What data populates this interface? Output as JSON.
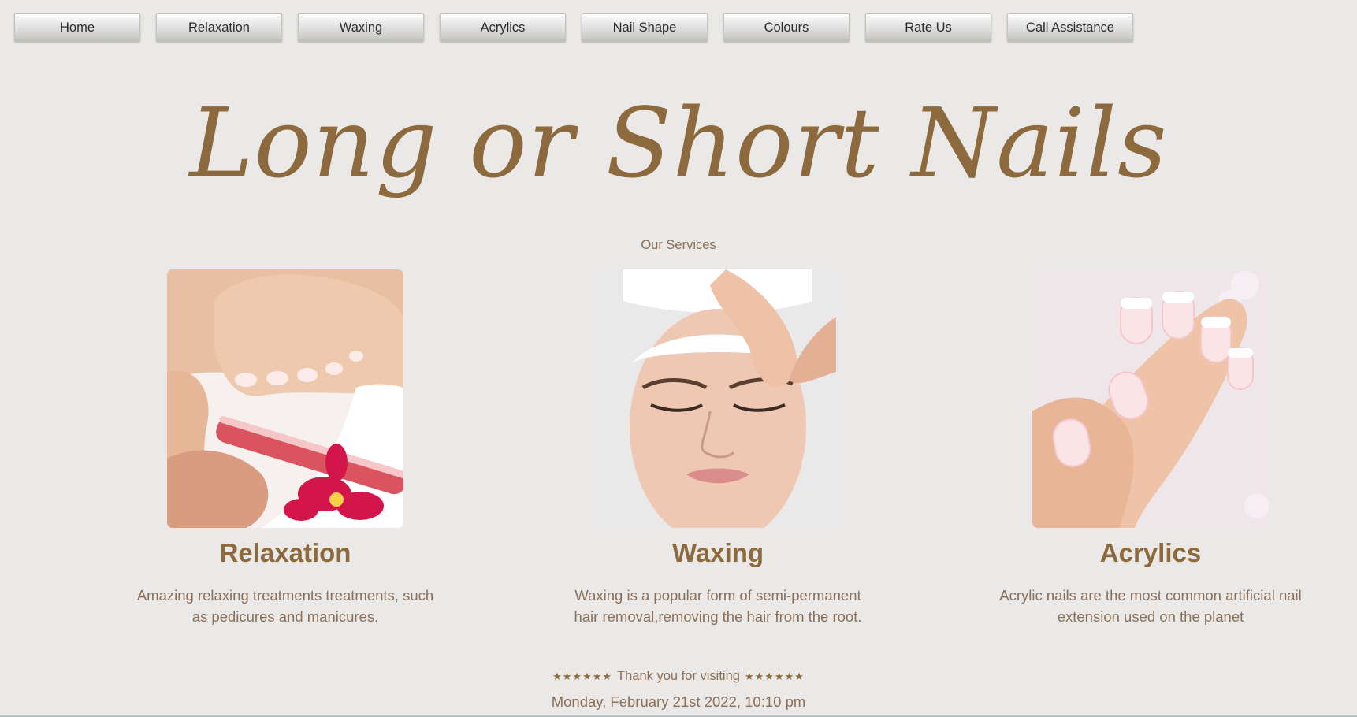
{
  "nav": {
    "items": [
      "Home",
      "Relaxation",
      "Waxing",
      "Acrylics",
      "Nail Shape",
      "Colours",
      "Rate Us",
      "Call Assistance"
    ]
  },
  "hero": {
    "title": "Long or Short Nails"
  },
  "services": {
    "label": "Our Services",
    "cards": [
      {
        "title": "Relaxation",
        "description": "Amazing relaxing treatments treatments, such as pedicures and manicures."
      },
      {
        "title": "Waxing",
        "description": "Waxing is a popular form of semi-permanent hair removal,removing the hair from the root."
      },
      {
        "title": "Acrylics",
        "description": "Acrylic nails are the most common artificial nail extension used on the planet"
      }
    ]
  },
  "footer": {
    "stars_left": "★★★★★★",
    "thanks": "Thank you for visiting",
    "stars_right": "★★★★★★",
    "date": "Monday, February 21st 2022, 10:10 pm"
  },
  "colors": {
    "accent": "#8d6a3e",
    "background": "#eae9e8",
    "text_muted": "#8b6f56"
  }
}
